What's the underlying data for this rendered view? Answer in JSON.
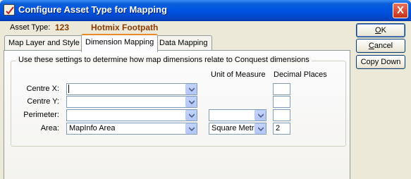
{
  "window": {
    "title": "Configure Asset Type for Mapping",
    "close_glyph": "X"
  },
  "asset": {
    "label": "Asset Type:",
    "code": "123",
    "name": "Hotmix Footpath"
  },
  "tabs": [
    {
      "label": "Map Layer and Style",
      "active": false
    },
    {
      "label": "Dimension Mapping",
      "active": true
    },
    {
      "label": "Data Mapping",
      "active": false
    }
  ],
  "dimension": {
    "group_title": "Use these settings to determine how map dimensions relate to Conquest dimensions",
    "col_unit": "Unit of Measure",
    "col_decimals": "Decimal Places",
    "rows": [
      {
        "label": "Centre X:",
        "value": "",
        "unit": null,
        "decimals": ""
      },
      {
        "label": "Centre Y:",
        "value": "",
        "unit": null,
        "decimals": ""
      },
      {
        "label": "Perimeter:",
        "value": "",
        "unit": "",
        "decimals": ""
      },
      {
        "label": "Area:",
        "value": "MapInfo Area",
        "unit": "Square Metre",
        "decimals": "2"
      }
    ]
  },
  "buttons": {
    "ok_accel": "O",
    "ok_rest": "K",
    "cancel_accel": "C",
    "cancel_rest": "ancel",
    "copy_down": "Copy Down"
  },
  "colors": {
    "titlebar": "#0054e3",
    "asset_text": "#8b3a00",
    "active_tab_accent": "#e68b2c"
  },
  "icons": {
    "app": "edit-checkbox-icon",
    "dropdown": "chevron-down-icon"
  }
}
